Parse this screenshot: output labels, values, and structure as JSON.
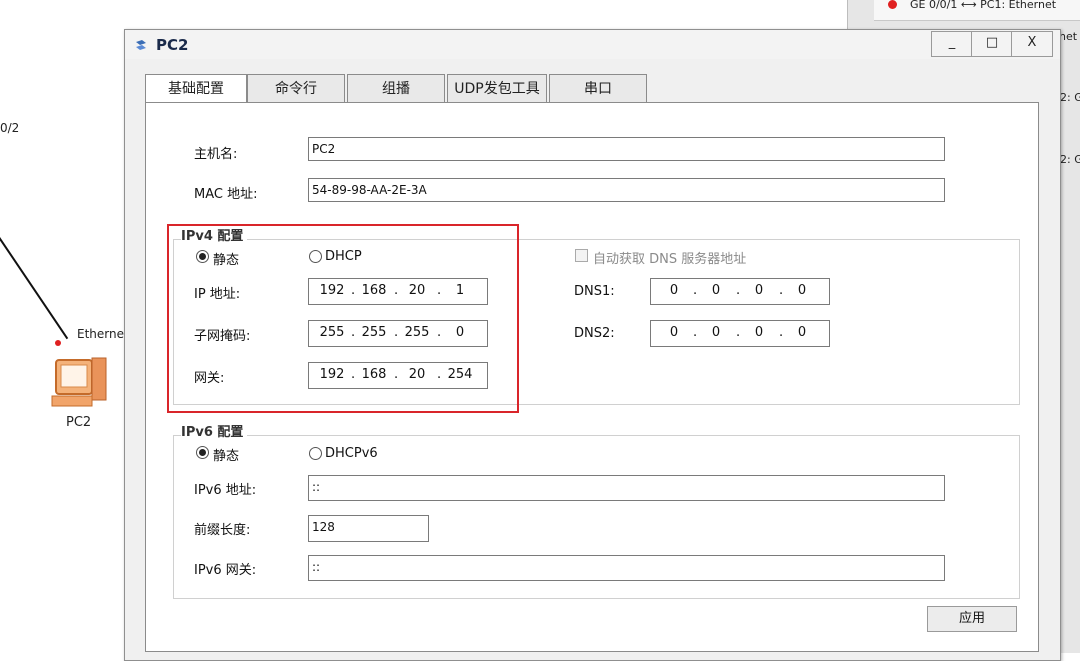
{
  "background": {
    "left_label": "0/2",
    "link_label": "Ethernet",
    "device_label": "PC2",
    "right_panel": {
      "row1": "GE 0/0/1 ⟷ PC1: Ethernet",
      "row1b": "net",
      "row2": "2: G",
      "row3": "2: G"
    }
  },
  "dialog": {
    "title": "PC2",
    "minimize": "_",
    "maximize": "□",
    "close": "X",
    "tabs": [
      "基础配置",
      "命令行",
      "组播",
      "UDP发包工具",
      "串口"
    ],
    "hostname_label": "主机名:",
    "hostname_value": "PC2",
    "mac_label": "MAC 地址:",
    "mac_value": "54-89-98-AA-2E-3A",
    "ipv4": {
      "title": "IPv4 配置",
      "static_label": "静态",
      "dhcp_label": "DHCP",
      "auto_dns_label": "自动获取 DNS 服务器地址",
      "ip_label": "IP 地址:",
      "ip": [
        "192",
        "168",
        "20",
        "1"
      ],
      "mask_label": "子网掩码:",
      "mask": [
        "255",
        "255",
        "255",
        "0"
      ],
      "gateway_label": "网关:",
      "gateway": [
        "192",
        "168",
        "20",
        "254"
      ],
      "dns1_label": "DNS1:",
      "dns1": [
        "0",
        "0",
        "0",
        "0"
      ],
      "dns2_label": "DNS2:",
      "dns2": [
        "0",
        "0",
        "0",
        "0"
      ]
    },
    "ipv6": {
      "title": "IPv6 配置",
      "static_label": "静态",
      "dhcp_label": "DHCPv6",
      "ip_label": "IPv6 地址:",
      "ip_value": "::",
      "prefix_label": "前缀长度:",
      "prefix_value": "128",
      "gateway_label": "IPv6 网关:",
      "gateway_value": "::"
    },
    "apply_label": "应用"
  },
  "colors": {
    "highlight": "#d9252a",
    "title": "#1a2a4a"
  }
}
